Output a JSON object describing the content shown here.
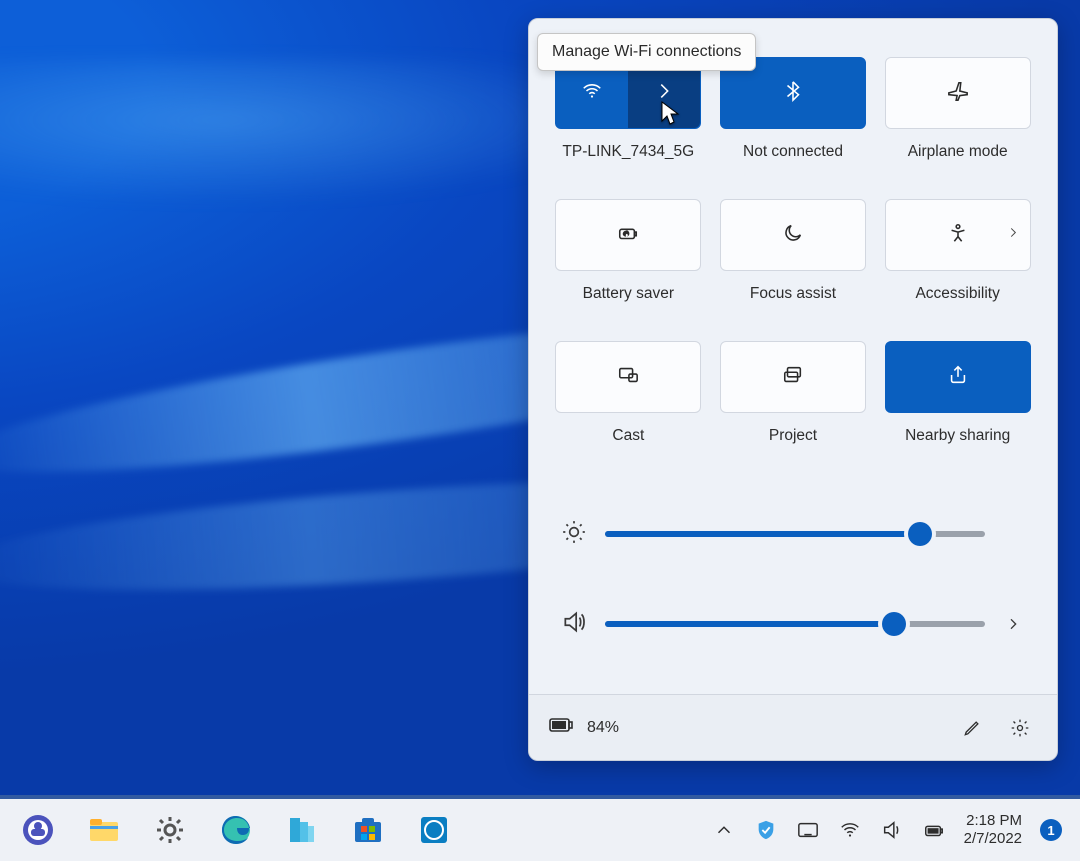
{
  "tooltip": {
    "text": "Manage Wi-Fi connections"
  },
  "quick_settings": {
    "tiles": {
      "wifi": {
        "label": "TP-LINK_7434_5G"
      },
      "bluetooth": {
        "label": "Not connected"
      },
      "airplane": {
        "label": "Airplane mode"
      },
      "battery_saver": {
        "label": "Battery saver"
      },
      "focus": {
        "label": "Focus assist"
      },
      "accessibility": {
        "label": "Accessibility"
      },
      "cast": {
        "label": "Cast"
      },
      "project": {
        "label": "Project"
      },
      "nearby": {
        "label": "Nearby sharing"
      }
    },
    "sliders": {
      "brightness": {
        "value": 83
      },
      "volume": {
        "value": 76
      }
    },
    "footer": {
      "battery_percent": "84%"
    }
  },
  "taskbar": {
    "clock": {
      "time": "2:18 PM",
      "date": "2/7/2022"
    },
    "notification_count": "1"
  }
}
